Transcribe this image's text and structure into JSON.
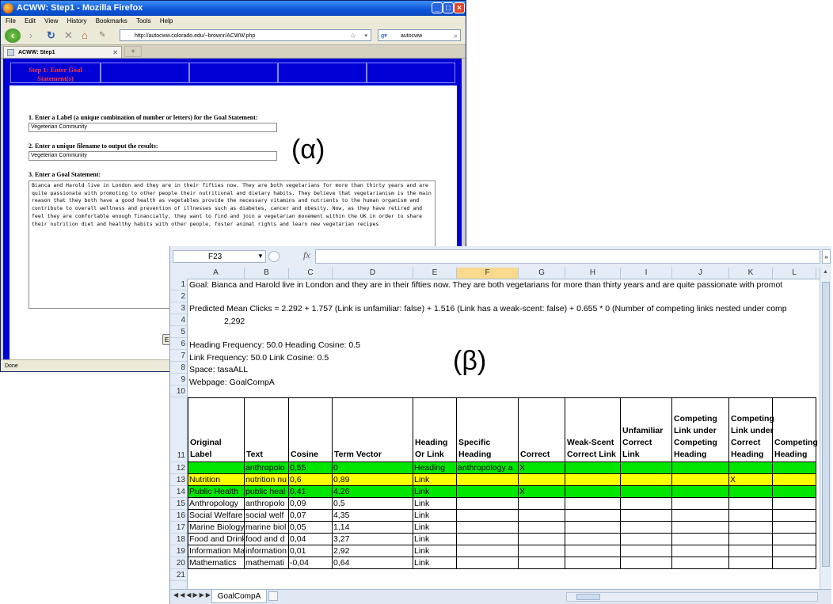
{
  "firefox": {
    "window_title": "ACWW: Step1 - Mozilla Firefox",
    "menu": [
      "File",
      "Edit",
      "View",
      "History",
      "Bookmarks",
      "Tools",
      "Help"
    ],
    "url": "http://autocww.colorado.edu/~brownr/ACWW.php",
    "search_value": "autocww",
    "tab_title": "ACWW: Step1",
    "status": "Done",
    "step_header": "Step 1: Enter Goal Statement(s)",
    "field1_label": "1. Enter a Label (a unique combination of number or letters) for the Goal Statement:",
    "field1_value": "Vegeterian Community",
    "field2_label": "2. Enter a unique filename to output the results:",
    "field2_value": "Vegeterian Community",
    "field3_label": "3. Enter a Goal Statement:",
    "goal_statement": "Bianca and Harold live in London and they are in their fifties now. They are both vegetarians for more than thirty years and are quite passionate with promoting to other people their nutritional and dietary habits. They believe that vegetarianism is the main reason that they both have a good health as vegetables provide the necessary vitamins and nutrients to the human organism and contribute to overall wellness and prevention of illnesses such as diabetes, cancer and obesity. Now, as they have retired and feel they are comfortable enough financially, they want to find and join a vegetarian movement within the UK in order to share their nutrition diet and healthy habits with other people, foster animal rights and learn new vegetarian recipes",
    "partial_button": "E"
  },
  "alpha_label": "(α)",
  "beta_label": "(β)",
  "excel": {
    "name_box": "F23",
    "fx": "fx",
    "columns": [
      "A",
      "B",
      "C",
      "D",
      "E",
      "F",
      "G",
      "H",
      "I",
      "J",
      "K",
      "L"
    ],
    "rows": [
      "1",
      "2",
      "3",
      "4",
      "5",
      "6",
      "7",
      "8",
      "9",
      "10",
      "11",
      "12",
      "13",
      "14",
      "15",
      "16",
      "17",
      "18",
      "19",
      "20",
      "21"
    ],
    "text_rows": {
      "r1": "Goal: Bianca and Harold live in London and they are in their fifties now. They are both vegetarians for more than thirty years and are quite passionate with promot",
      "r3": "Predicted Mean Clicks = 2.292 + 1.757 (Link is unfamiliar: false) + 1.516 (Link has a weak-scent: false) + 0.655 * 0 (Number of competing links nested under comp",
      "r4": "2,292",
      "r6": "Heading Frequency: 50.0 Heading Cosine: 0.5",
      "r7": "Link Frequency: 50.0 Link Cosine: 0.5",
      "r8": "Space: tasaALL",
      "r9": "Webpage: GoalCompA"
    },
    "headers": [
      "Original Label",
      "Text",
      "Cosine",
      "Term Vector",
      "Heading Or Link",
      "Specific Heading",
      "Correct",
      "Weak-Scent Correct Link",
      "Unfamiliar Correct Link",
      "Competing Link under Competing Heading",
      "Competing Link under Correct Heading",
      "Competing Heading"
    ],
    "table": [
      [
        "",
        "anthropolo",
        "0,55",
        "0",
        "Heading",
        "anthropology a",
        "X",
        "",
        "",
        "",
        "",
        ""
      ],
      [
        "Nutrition",
        "nutrition nu",
        "0,6",
        "0,89",
        "Link",
        "",
        "",
        "",
        "",
        "",
        "X",
        ""
      ],
      [
        "Public Health",
        "public heal",
        "0,41",
        "4,26",
        "Link",
        "",
        "X",
        "",
        "",
        "",
        "",
        ""
      ],
      [
        "Anthropology",
        "anthropolo",
        "0,09",
        "0,5",
        "Link",
        "",
        "",
        "",
        "",
        "",
        "",
        ""
      ],
      [
        "Social Welfare",
        "social welf",
        "0,07",
        "4,35",
        "Link",
        "",
        "",
        "",
        "",
        "",
        "",
        ""
      ],
      [
        "Marine Biology",
        "marine biol",
        "0,05",
        "1,14",
        "Link",
        "",
        "",
        "",
        "",
        "",
        "",
        ""
      ],
      [
        "Food and Drink",
        "food and d",
        "0,04",
        "3,27",
        "Link",
        "",
        "",
        "",
        "",
        "",
        "",
        ""
      ],
      [
        "Information Ma",
        "information",
        "0,01",
        "2,92",
        "Link",
        "",
        "",
        "",
        "",
        "",
        "",
        ""
      ],
      [
        "Mathematics",
        "mathemati",
        "-0,04",
        "0,64",
        "Link",
        "",
        "",
        "",
        "",
        "",
        "",
        ""
      ]
    ],
    "sheet_tab": "GoalCompA",
    "row_colors": {
      "green": "#00e600",
      "yellow": "#ffff00"
    }
  }
}
